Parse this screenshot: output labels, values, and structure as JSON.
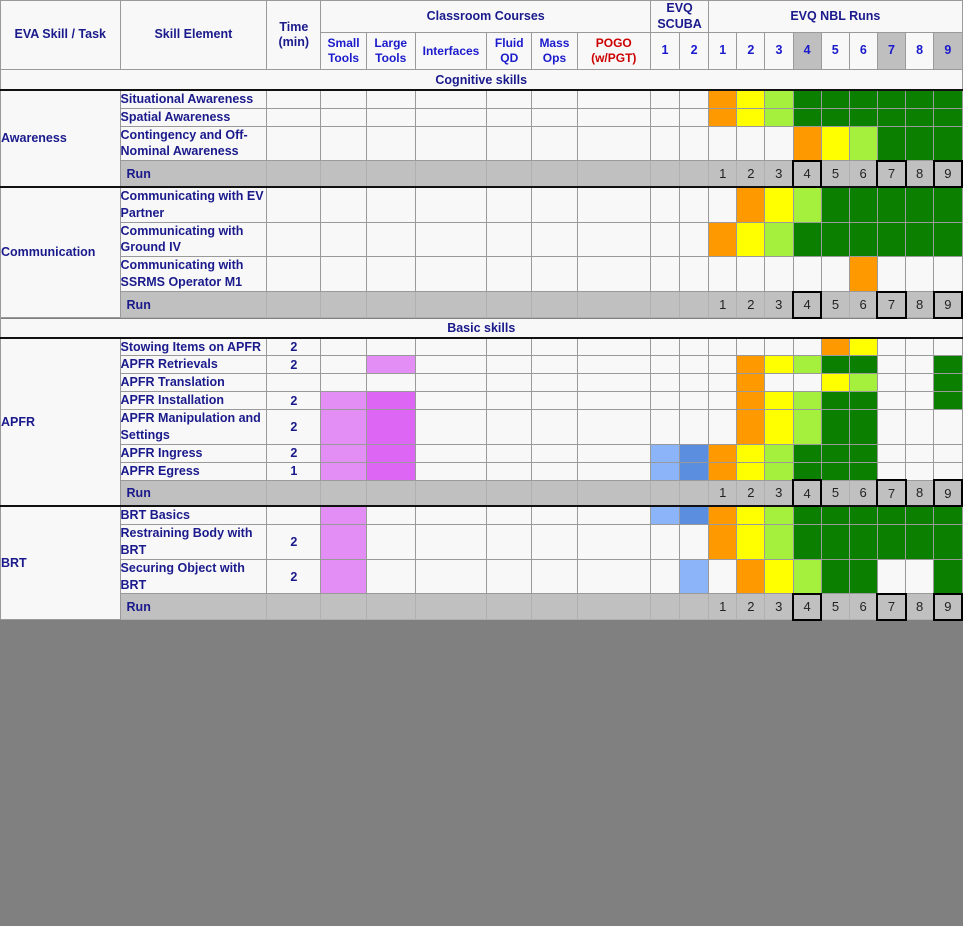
{
  "header": {
    "col_eva_skill": "EVA Skill / Task",
    "col_skill_element": "Skill Element",
    "col_time": "Time (min)",
    "col_time_line1": "Time",
    "col_time_line2": "(min)",
    "group_classroom": "Classroom Courses",
    "group_scuba": "EVQ SCUBA",
    "group_scuba_line1": "EVQ",
    "group_scuba_line2": "SCUBA",
    "group_nbl": "EVQ NBL Runs",
    "classroom_cols": [
      "Small Tools",
      "Large Tools",
      "Interfaces",
      "Fluid QD",
      "Mass Ops",
      "POGO (w/PGT)"
    ],
    "classroom_cols_lines": [
      [
        "Small",
        "Tools"
      ],
      [
        "Large",
        "Tools"
      ],
      [
        "Interfaces",
        ""
      ],
      [
        "Fluid",
        "QD"
      ],
      [
        "Mass",
        "Ops"
      ],
      [
        "POGO",
        "(w/PGT)"
      ]
    ],
    "scuba_cols": [
      "1",
      "2"
    ],
    "nbl_cols": [
      "1",
      "2",
      "3",
      "4",
      "5",
      "6",
      "7",
      "8",
      "9"
    ],
    "nbl_shaded": [
      false,
      false,
      false,
      true,
      false,
      false,
      true,
      false,
      true
    ]
  },
  "run_row": {
    "label": "Run",
    "numbers": [
      "1",
      "2",
      "3",
      "4",
      "5",
      "6",
      "7",
      "8",
      "9"
    ],
    "boxed": [
      false,
      false,
      false,
      true,
      false,
      false,
      true,
      false,
      true
    ]
  },
  "colors": {
    "orange": "#ff9900",
    "yellow": "#ffff00",
    "light_green": "#a4f03c",
    "green": "#0b8000",
    "blue_light": "#8cb4f8",
    "blue_dark": "#5c8ee0",
    "purple_light": "#e38ef5",
    "purple_bright": "#dd66f5",
    "band_gray": "#808080",
    "group_gray": "#c0c0c0",
    "label_blue": "#1a1a8c",
    "pogo_red": "#cc0000"
  },
  "sections": [
    {
      "band": "Cognitive skills",
      "groups": [
        {
          "task": "Awareness",
          "rows": [
            {
              "element": "Situational Awareness",
              "time": "",
              "classroom": [
                "",
                "",
                "",
                "",
                "",
                ""
              ],
              "scuba": [
                "",
                ""
              ],
              "nbl": [
                "orange",
                "yellow",
                "light_green",
                "green",
                "green",
                "green",
                "green",
                "green",
                "green"
              ]
            },
            {
              "element": "Spatial Awareness",
              "time": "",
              "classroom": [
                "",
                "",
                "",
                "",
                "",
                ""
              ],
              "scuba": [
                "",
                ""
              ],
              "nbl": [
                "orange",
                "yellow",
                "light_green",
                "green",
                "green",
                "green",
                "green",
                "green",
                "green"
              ]
            },
            {
              "element": "Contingency and Off-Nominal Awareness",
              "time": "",
              "classroom": [
                "",
                "",
                "",
                "",
                "",
                ""
              ],
              "scuba": [
                "",
                ""
              ],
              "nbl": [
                "",
                "",
                "",
                "orange",
                "yellow",
                "light_green",
                "green",
                "green",
                "green"
              ]
            }
          ]
        },
        {
          "task": "Communication",
          "rows": [
            {
              "element": "Communicating with EV Partner",
              "time": "",
              "classroom": [
                "",
                "",
                "",
                "",
                "",
                ""
              ],
              "scuba": [
                "",
                ""
              ],
              "nbl": [
                "",
                "orange",
                "yellow",
                "light_green",
                "green",
                "green",
                "green",
                "green",
                "green"
              ]
            },
            {
              "element": "Communicating with Ground IV",
              "time": "",
              "classroom": [
                "",
                "",
                "",
                "",
                "",
                ""
              ],
              "scuba": [
                "",
                ""
              ],
              "nbl": [
                "orange",
                "yellow",
                "light_green",
                "green",
                "green",
                "green",
                "green",
                "green",
                "green"
              ]
            },
            {
              "element": "Communicating with SSRMS Operator M1",
              "time": "",
              "classroom": [
                "",
                "",
                "",
                "",
                "",
                ""
              ],
              "scuba": [
                "",
                ""
              ],
              "nbl": [
                "",
                "",
                "",
                "",
                "",
                "orange",
                "",
                "",
                ""
              ]
            }
          ]
        }
      ]
    },
    {
      "band": "Basic skills",
      "groups": [
        {
          "task": "APFR",
          "rows": [
            {
              "element": "Stowing Items on APFR",
              "time": "2",
              "classroom": [
                "",
                "",
                "",
                "",
                "",
                ""
              ],
              "scuba": [
                "",
                ""
              ],
              "nbl": [
                "",
                "",
                "",
                "",
                "orange",
                "yellow",
                "",
                "",
                ""
              ]
            },
            {
              "element": "APFR Retrievals",
              "time": "2",
              "classroom": [
                "",
                "purple_light",
                "",
                "",
                "",
                ""
              ],
              "scuba": [
                "",
                ""
              ],
              "nbl": [
                "",
                "orange",
                "yellow",
                "light_green",
                "green",
                "green",
                "",
                "",
                "green"
              ]
            },
            {
              "element": "APFR Translation",
              "time": "",
              "classroom": [
                "",
                "",
                "",
                "",
                "",
                ""
              ],
              "scuba": [
                "",
                ""
              ],
              "nbl": [
                "",
                "orange",
                "",
                "",
                "yellow",
                "light_green",
                "",
                "",
                "green"
              ]
            },
            {
              "element": "APFR Installation",
              "time": "2",
              "classroom": [
                "purple_light",
                "purple_bright",
                "",
                "",
                "",
                ""
              ],
              "scuba": [
                "",
                ""
              ],
              "nbl": [
                "",
                "orange",
                "yellow",
                "light_green",
                "green",
                "green",
                "",
                "",
                "green"
              ]
            },
            {
              "element": "APFR Manipulation and Settings",
              "time": "2",
              "classroom": [
                "purple_light",
                "purple_bright",
                "",
                "",
                "",
                ""
              ],
              "scuba": [
                "",
                ""
              ],
              "nbl": [
                "",
                "orange",
                "yellow",
                "light_green",
                "green",
                "green",
                "",
                "",
                ""
              ]
            },
            {
              "element": "APFR Ingress",
              "time": "2",
              "classroom": [
                "purple_light",
                "purple_bright",
                "",
                "",
                "",
                ""
              ],
              "scuba": [
                "blue_light",
                "blue_dark"
              ],
              "nbl": [
                "orange",
                "yellow",
                "light_green",
                "green",
                "green",
                "green",
                "",
                "",
                ""
              ]
            },
            {
              "element": "APFR Egress",
              "time": "1",
              "classroom": [
                "purple_light",
                "purple_bright",
                "",
                "",
                "",
                ""
              ],
              "scuba": [
                "blue_light",
                "blue_dark"
              ],
              "nbl": [
                "orange",
                "yellow",
                "light_green",
                "green",
                "green",
                "green",
                "",
                "",
                ""
              ]
            }
          ]
        },
        {
          "task": "BRT",
          "rows": [
            {
              "element": "BRT Basics",
              "time": "",
              "classroom": [
                "purple_light",
                "",
                "",
                "",
                "",
                ""
              ],
              "scuba": [
                "blue_light",
                "blue_dark"
              ],
              "nbl": [
                "orange",
                "yellow",
                "light_green",
                "green",
                "green",
                "green",
                "green",
                "green",
                "green"
              ]
            },
            {
              "element": "Restraining Body with BRT",
              "time": "2",
              "classroom": [
                "purple_light",
                "",
                "",
                "",
                "",
                ""
              ],
              "scuba": [
                "",
                ""
              ],
              "nbl": [
                "orange",
                "yellow",
                "light_green",
                "green",
                "green",
                "green",
                "green",
                "green",
                "green"
              ]
            },
            {
              "element": "Securing Object with BRT",
              "time": "2",
              "classroom": [
                "purple_light",
                "",
                "",
                "",
                "",
                ""
              ],
              "scuba": [
                "",
                "blue_light"
              ],
              "nbl": [
                "",
                "orange",
                "yellow",
                "light_green",
                "green",
                "green",
                "",
                "",
                "green"
              ]
            }
          ]
        }
      ]
    }
  ]
}
